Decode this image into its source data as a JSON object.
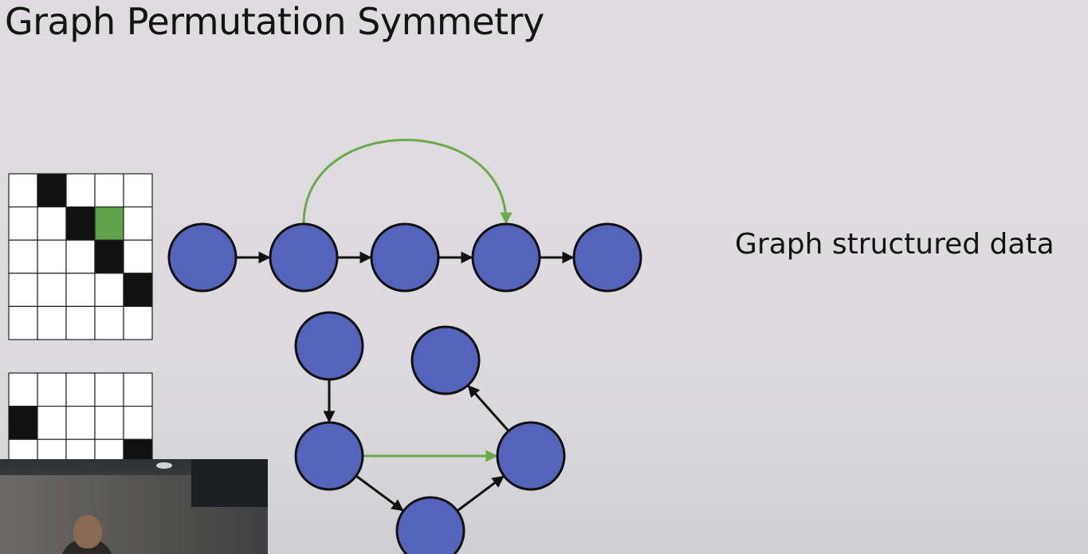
{
  "slide": {
    "title": "Graph Permutation Symmetry",
    "side_label": "Graph structured data"
  },
  "colors": {
    "node_fill": "#5563bb",
    "node_stroke": "#111111",
    "edge": "#111111",
    "highlight_edge": "#6aaa4a",
    "matrix_filled": "#111111",
    "matrix_highlight": "#5fa24a",
    "matrix_empty": "#ffffff"
  },
  "matrices": [
    {
      "id": "adjacency-top",
      "rows": 5,
      "cols": 5,
      "cells": [
        [
          0,
          1,
          0,
          0,
          0
        ],
        [
          0,
          0,
          1,
          2,
          0
        ],
        [
          0,
          0,
          0,
          1,
          0
        ],
        [
          0,
          0,
          0,
          0,
          1
        ],
        [
          0,
          0,
          0,
          0,
          0
        ]
      ]
    },
    {
      "id": "adjacency-bottom",
      "rows": 3,
      "cols": 5,
      "cells": [
        [
          0,
          0,
          0,
          0,
          0
        ],
        [
          1,
          0,
          0,
          0,
          0
        ],
        [
          0,
          0,
          0,
          0,
          1
        ]
      ]
    }
  ],
  "graphs": {
    "chain": {
      "node_count": 5,
      "edges": [
        [
          0,
          1
        ],
        [
          1,
          2
        ],
        [
          2,
          3
        ],
        [
          3,
          4
        ]
      ],
      "highlight_edges": [
        [
          1,
          3
        ]
      ]
    },
    "dag": {
      "node_count": 5,
      "edges": [
        [
          0,
          2
        ],
        [
          2,
          4
        ],
        [
          4,
          3
        ],
        [
          3,
          1
        ]
      ],
      "highlight_edges": [
        [
          2,
          3
        ]
      ]
    }
  },
  "webcam": {
    "icon": "presenter-video-icon"
  }
}
